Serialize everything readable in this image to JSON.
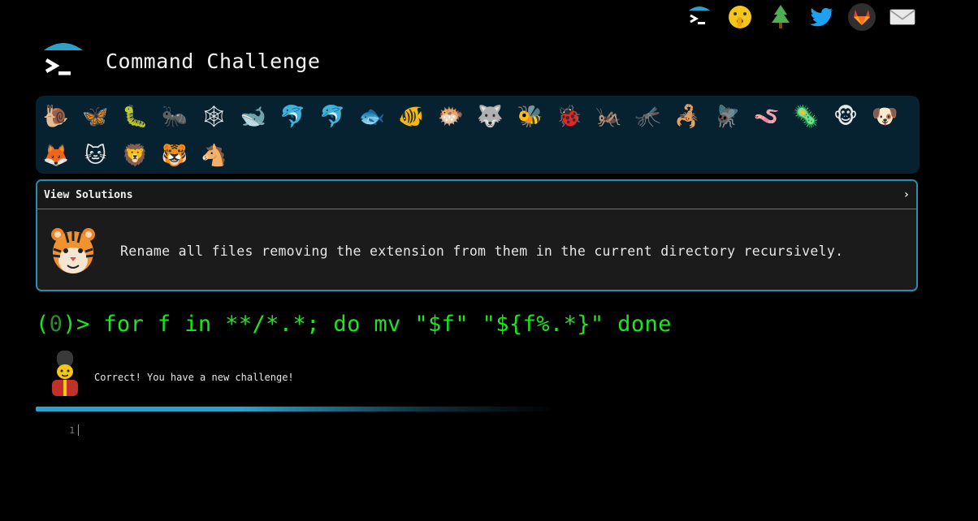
{
  "app": {
    "title": "Command Challenge"
  },
  "top_links": [
    {
      "icon": "terminal-logo-icon"
    },
    {
      "icon": "shushing-face-icon",
      "glyph": "🤫"
    },
    {
      "icon": "tree-icon",
      "glyph": "🌲"
    },
    {
      "icon": "twitter-icon"
    },
    {
      "icon": "gitlab-icon"
    },
    {
      "icon": "mail-icon"
    }
  ],
  "levels": [
    {
      "name": "snail",
      "glyph": "🐌"
    },
    {
      "name": "butterfly",
      "glyph": "🦋"
    },
    {
      "name": "caterpillar",
      "glyph": "🐛"
    },
    {
      "name": "ant",
      "glyph": "🐜"
    },
    {
      "name": "spider-web",
      "glyph": "🕸"
    },
    {
      "name": "whale",
      "glyph": "🐋"
    },
    {
      "name": "dolphin-blue",
      "glyph": "🐬"
    },
    {
      "name": "dolphin-grey",
      "glyph": "🐬"
    },
    {
      "name": "fish",
      "glyph": "🐟"
    },
    {
      "name": "tropical-fish",
      "glyph": "🐠"
    },
    {
      "name": "blowfish",
      "glyph": "🐡"
    },
    {
      "name": "wolf",
      "glyph": "🐺"
    },
    {
      "name": "bee",
      "glyph": "🐝"
    },
    {
      "name": "ladybug",
      "glyph": "🐞"
    },
    {
      "name": "cricket",
      "glyph": "🦗"
    },
    {
      "name": "mosquito",
      "glyph": "🦟"
    },
    {
      "name": "scorpion",
      "glyph": "🦂"
    },
    {
      "name": "fly",
      "glyph": "🪰"
    },
    {
      "name": "worm",
      "glyph": "🪱"
    },
    {
      "name": "microbe",
      "glyph": "🦠"
    },
    {
      "name": "monkey",
      "glyph": "🐵"
    },
    {
      "name": "dog",
      "glyph": "🐶"
    },
    {
      "name": "fox",
      "glyph": "🦊"
    },
    {
      "name": "cat",
      "glyph": "🐱"
    },
    {
      "name": "lion",
      "glyph": "🦁"
    },
    {
      "name": "tiger",
      "glyph": "🐯"
    },
    {
      "name": "horse",
      "glyph": "🐴"
    }
  ],
  "challenge": {
    "view_solutions_label": "View Solutions",
    "chevron": "›",
    "avatar": "tiger-face",
    "description": "Rename all files removing the extension from them in the current directory recursively."
  },
  "command": {
    "open_paren": "(",
    "exit_code": "0",
    "prompt_tail": ")> ",
    "text": "for f in **/*.*; do mv \"$f\" \"${f%.*}\" done"
  },
  "result": {
    "avatar": "guard",
    "message": "Correct! You have a new challenge!"
  },
  "editor": {
    "line_number": "1"
  },
  "colors": {
    "accent": "#2aa2c9",
    "prompt_green": "#19e81d",
    "levels_bg": "#062230",
    "panel_bg": "#1b1b1b"
  }
}
